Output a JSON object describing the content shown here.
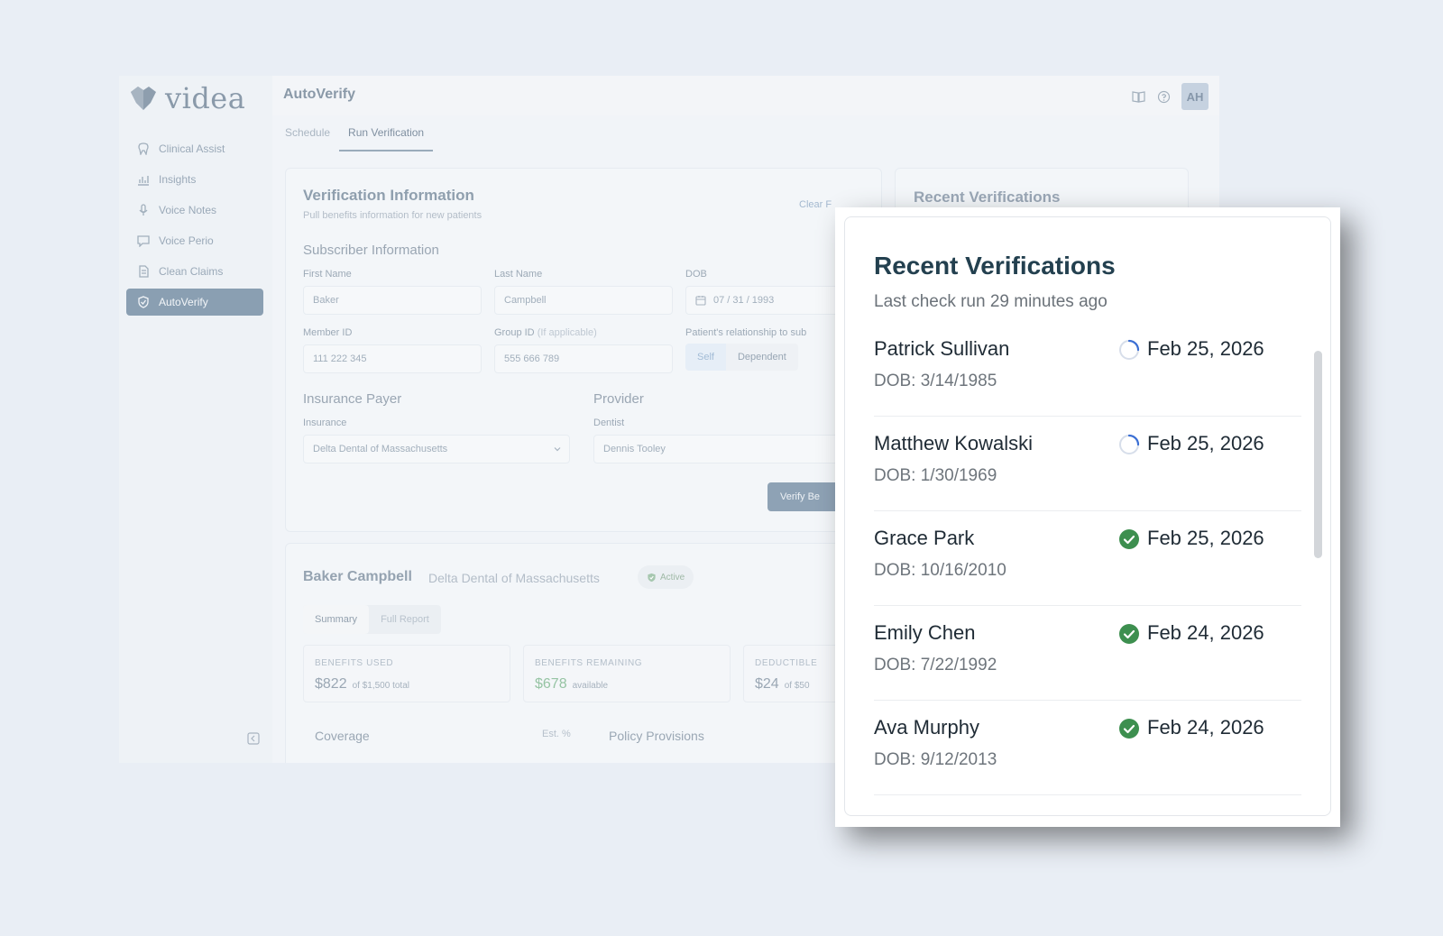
{
  "brand": {
    "name": "videa"
  },
  "sidebar": {
    "items": [
      {
        "label": "Clinical Assist",
        "icon": "tooth-icon"
      },
      {
        "label": "Insights",
        "icon": "chart-icon"
      },
      {
        "label": "Voice Notes",
        "icon": "microphone-icon"
      },
      {
        "label": "Voice Perio",
        "icon": "chat-bubble-icon"
      },
      {
        "label": "Clean Claims",
        "icon": "document-icon"
      },
      {
        "label": "AutoVerify",
        "icon": "shield-check-icon",
        "active": true
      }
    ]
  },
  "header": {
    "title": "AutoVerify",
    "avatar": "AH"
  },
  "tabs": [
    {
      "label": "Schedule"
    },
    {
      "label": "Run Verification",
      "active": true
    }
  ],
  "verification": {
    "title": "Verification Information",
    "subtitle": "Pull benefits information for new patients",
    "clear_label": "Clear F",
    "subscriber_heading": "Subscriber Information",
    "first_name": {
      "label": "First Name",
      "value": "Baker"
    },
    "last_name": {
      "label": "Last Name",
      "value": "Campbell"
    },
    "dob": {
      "label": "DOB",
      "value": "07 / 31 / 1993"
    },
    "member_id": {
      "label": "Member ID",
      "value": "111 222 345"
    },
    "group_id": {
      "label": "Group ID",
      "hint": "(If applicable)",
      "value": "555 666 789"
    },
    "relationship": {
      "label": "Patient's relationship to sub",
      "options": [
        "Self",
        "Dependent"
      ],
      "selected": "Self"
    },
    "payer_heading": "Insurance Payer",
    "insurance": {
      "label": "Insurance",
      "value": "Delta Dental of Massachusetts"
    },
    "provider_heading": "Provider",
    "dentist": {
      "label": "Dentist",
      "value": "Dennis Tooley"
    },
    "verify_label": "Verify Be"
  },
  "result": {
    "name": "Baker Campbell",
    "payer": "Delta Dental of Massachusetts",
    "status": "Active",
    "subtabs": [
      "Summary",
      "Full Report"
    ],
    "stats": [
      {
        "key": "BENEFITS USED",
        "value": "$822",
        "note": "of $1,500 total"
      },
      {
        "key": "BENEFITS REMAINING",
        "value": "$678",
        "note": "available"
      },
      {
        "key": "DEDUCTIBLE",
        "value": "$24",
        "note": "of $50"
      }
    ],
    "coverage_label": "Coverage",
    "est_label": "Est. %",
    "policy_label": "Policy Provisions"
  },
  "recent_bg": {
    "title": "Recent Verifications"
  },
  "popup": {
    "title": "Recent Verifications",
    "subtitle": "Last check run 29 minutes ago",
    "rows": [
      {
        "name": "Patrick Sullivan",
        "dob": "DOB: 3/14/1985",
        "date": "Feb 25, 2026",
        "status": "pending"
      },
      {
        "name": "Matthew Kowalski",
        "dob": "DOB: 1/30/1969",
        "date": "Feb 25, 2026",
        "status": "pending"
      },
      {
        "name": "Grace Park",
        "dob": "DOB: 10/16/2010",
        "date": "Feb 25, 2026",
        "status": "verified"
      },
      {
        "name": "Emily Chen",
        "dob": "DOB: 7/22/1992",
        "date": "Feb 24, 2026",
        "status": "verified"
      },
      {
        "name": "Ava Murphy",
        "dob": "DOB: 9/12/2013",
        "date": "Feb 24, 2026",
        "status": "verified"
      }
    ]
  },
  "colors": {
    "accent": "#8a9fb2",
    "verified": "#3d8f4f",
    "pending": "#3b6fd4",
    "title": "#23404f"
  }
}
